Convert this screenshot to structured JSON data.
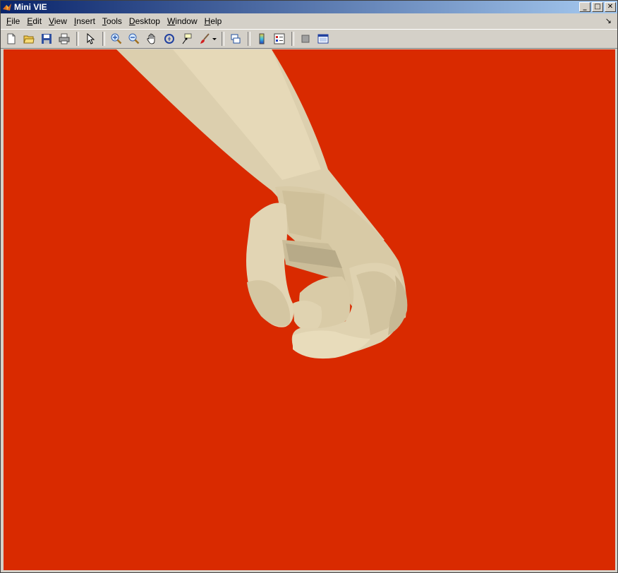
{
  "window": {
    "title": "Mini VIE",
    "controls": {
      "minimize": "_",
      "maximize": "□",
      "close": "✕"
    }
  },
  "menubar": {
    "items": [
      {
        "key": "file",
        "underline": "F",
        "rest": "ile"
      },
      {
        "key": "edit",
        "underline": "E",
        "rest": "dit"
      },
      {
        "key": "view",
        "underline": "V",
        "rest": "iew"
      },
      {
        "key": "insert",
        "underline": "I",
        "rest": "nsert"
      },
      {
        "key": "tools",
        "underline": "T",
        "rest": "ools"
      },
      {
        "key": "desktop",
        "underline": "D",
        "rest": "esktop"
      },
      {
        "key": "window",
        "underline": "W",
        "rest": "indow"
      },
      {
        "key": "help",
        "underline": "H",
        "rest": "elp"
      }
    ],
    "dock_arrow": "↘"
  },
  "toolbar": {
    "buttons": [
      "new-figure-icon",
      "open-file-icon",
      "save-figure-icon",
      "print-figure-icon",
      "edit-plot-arrow-icon",
      "zoom-in-icon",
      "zoom-out-icon",
      "pan-hand-icon",
      "rotate-3d-icon",
      "data-cursor-icon",
      "brush-icon",
      "link-plot-icon",
      "insert-colorbar-icon",
      "insert-legend-icon",
      "hide-plot-tools-icon",
      "show-plot-tools-icon"
    ]
  },
  "scene": {
    "background_color": "#d92a00",
    "model_color": "#dcd0b0",
    "description": "3D rendered prosthetic hand model"
  }
}
